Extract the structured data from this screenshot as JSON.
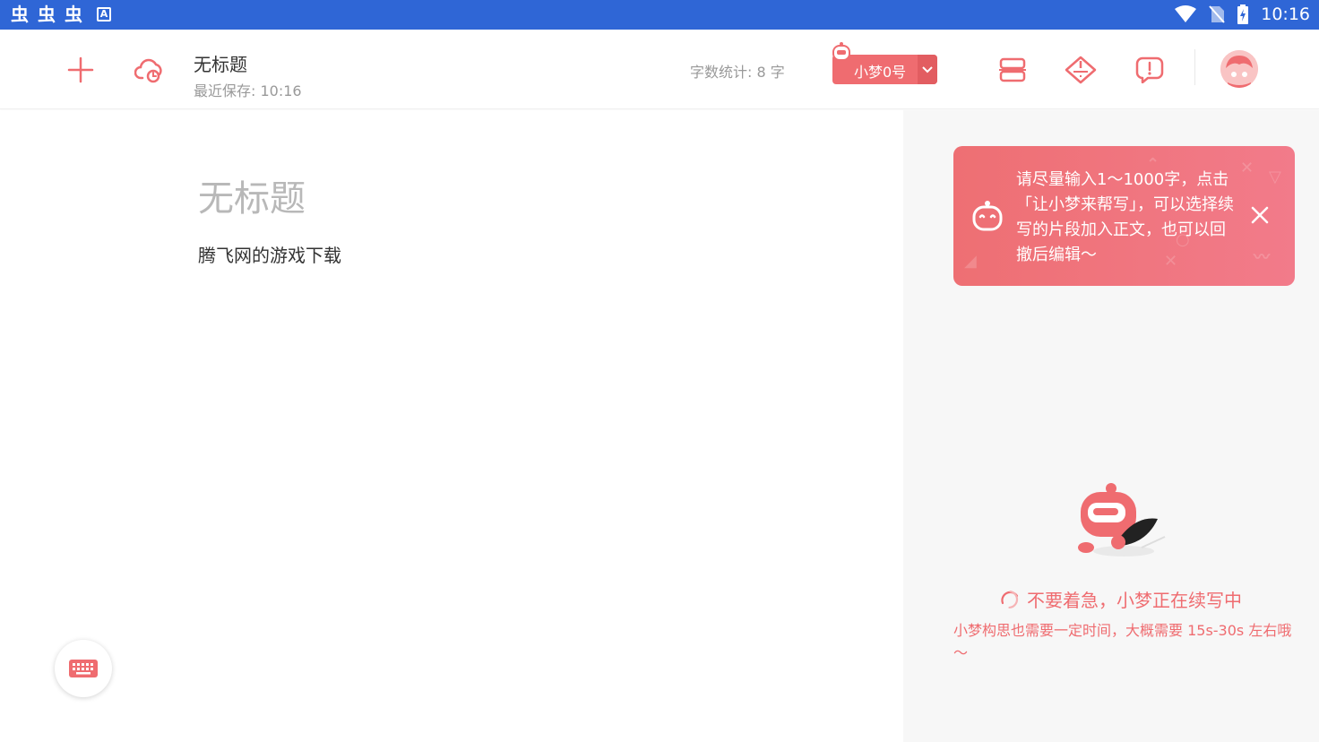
{
  "status_bar": {
    "left_glyphs": [
      "虫",
      "虫",
      "虫"
    ],
    "left_icon": "A",
    "time": "10:16"
  },
  "toolbar": {
    "doc_title": "无标题",
    "last_saved": "最近保存: 10:16",
    "word_count": "字数统计:  8 字",
    "model_label": "小梦0号"
  },
  "editor": {
    "title": "无标题",
    "body": "腾飞网的游戏下载"
  },
  "tip": {
    "text": "请尽量输入1～1000字，点击「让小梦来帮写」，可以选择续写的片段加入正文，也可以回撤后编辑～"
  },
  "loading": {
    "main": "不要着急，小梦正在续写中",
    "sub": "小梦构思也需要一定时间，大概需要 15s-30s 左右哦～"
  },
  "colors": {
    "accent": "#ef6c70",
    "status_bar": "#2f66d6",
    "panel_bg": "#f7f7f7"
  },
  "icons": [
    "add-icon",
    "cloud-sync-icon",
    "chevron-down-icon",
    "outline-icon",
    "diamond-icon",
    "feedback-icon",
    "keyboard-icon",
    "close-icon",
    "robot-icon",
    "spinner-icon",
    "wifi-icon",
    "no-sim-icon",
    "battery-icon"
  ]
}
